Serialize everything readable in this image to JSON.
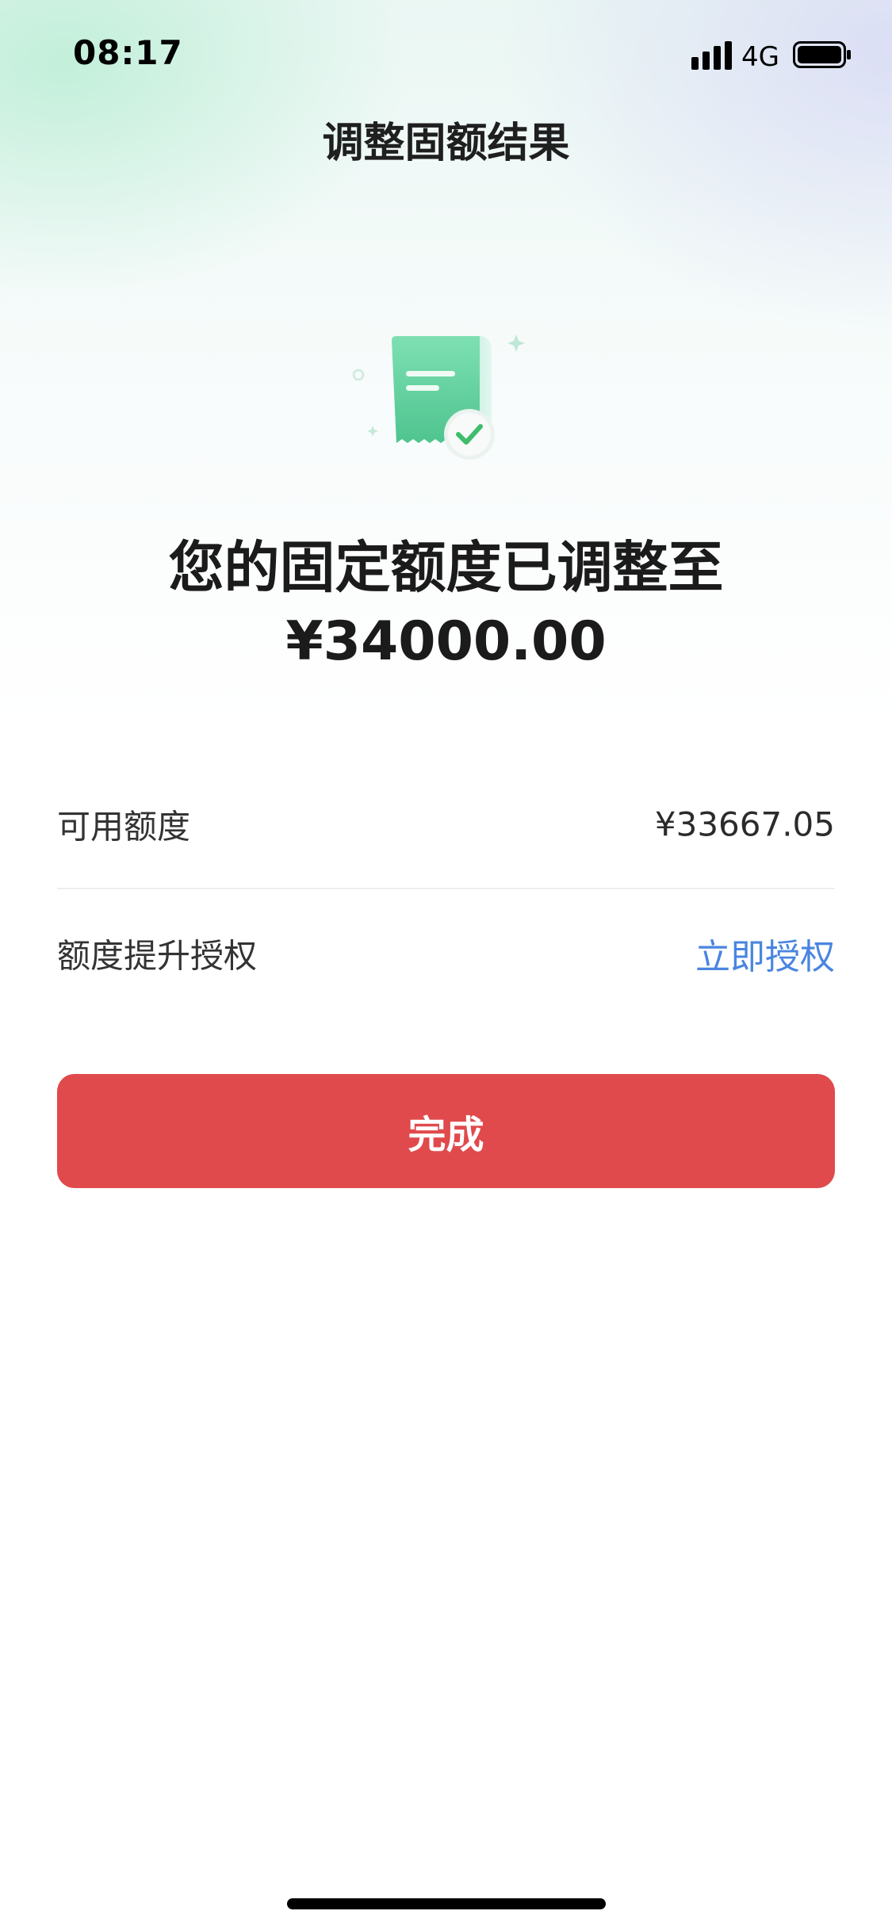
{
  "status_bar": {
    "time": "08:17",
    "network": "4G",
    "icons": [
      "signal-icon",
      "battery-icon"
    ]
  },
  "header": {
    "title": "调整固额结果"
  },
  "result": {
    "illustration_icon": "receipt-check-icon",
    "headline": "您的固定额度已调整至",
    "amount": "¥34000.00"
  },
  "details": [
    {
      "label": "可用额度",
      "value": "¥33667.05"
    },
    {
      "label": "额度提升授权",
      "link": "立即授权"
    }
  ],
  "actions": {
    "done_label": "完成"
  },
  "colors": {
    "primary_button": "#e04a4c",
    "link": "#4a85e0",
    "illustration_green": "#5fcf9c"
  }
}
